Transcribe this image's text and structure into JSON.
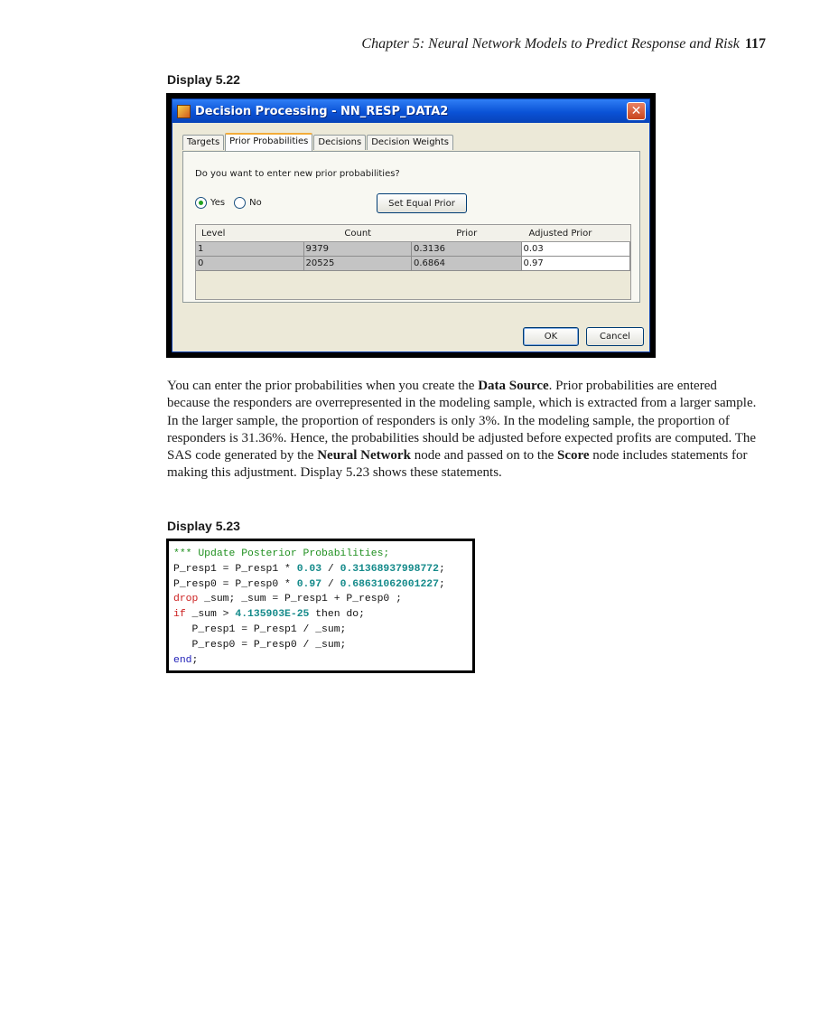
{
  "header": {
    "chapter": "Chapter 5: Neural Network Models to Predict Response and Risk",
    "page_number": "117"
  },
  "display_522": {
    "label": "Display 5.22",
    "dialog": {
      "title": "Decision Processing - NN_RESP_DATA2",
      "close": "✕",
      "tabs": [
        "Targets",
        "Prior Probabilities",
        "Decisions",
        "Decision Weights"
      ],
      "active_tab": "Prior Probabilities",
      "question": "Do you want to enter new prior probabilities?",
      "radio_yes": "Yes",
      "radio_no": "No",
      "selected_radio": "Yes",
      "set_equal_prior": "Set Equal Prior",
      "columns": [
        "Level",
        "Count",
        "Prior",
        "Adjusted Prior"
      ],
      "rows": [
        {
          "level": "1",
          "count": "9379",
          "prior": "0.3136",
          "adjusted": "0.03"
        },
        {
          "level": "0",
          "count": "20525",
          "prior": "0.6864",
          "adjusted": "0.97"
        }
      ],
      "ok": "OK",
      "cancel": "Cancel"
    }
  },
  "paragraph": {
    "t1": "You can enter the prior probabilities when you create the ",
    "b1": "Data Source",
    "t2": ". Prior probabilities are entered because the responders are overrepresented in the modeling sample, which is extracted from a larger sample. In the larger sample, the proportion of responders is only 3%. In the modeling sample, the proportion of responders is 31.36%. Hence, the probabilities should be adjusted before expected profits are computed. The SAS code generated by the ",
    "b2": "Neural Network",
    "t3": " node and passed on to the ",
    "b3": "Score",
    "t4": " node includes statements for making this adjustment. Display 5.23 shows these statements."
  },
  "display_523": {
    "label": "Display 5.23",
    "code": {
      "l1": "*** Update Posterior Probabilities;",
      "l2a": "P_resp1 = P_resp1 * ",
      "l2b": "0.03",
      "l2c": " / ",
      "l2d": "0.31368937998772",
      "l2e": ";",
      "l3a": "P_resp0 = P_resp0 * ",
      "l3b": "0.97",
      "l3c": " / ",
      "l3d": "0.68631062001227",
      "l3e": ";",
      "l4a": "drop",
      "l4b": " _sum; _sum = P_resp1 + P_resp0 ;",
      "l5a": "if",
      "l5b": " _sum > ",
      "l5c": "4.135903E-25",
      "l5d": " then do;",
      "l6": "   P_resp1 = P_resp1 / _sum;",
      "l7": "   P_resp0 = P_resp0 / _sum;",
      "l8a": "end",
      "l8b": ";"
    }
  }
}
